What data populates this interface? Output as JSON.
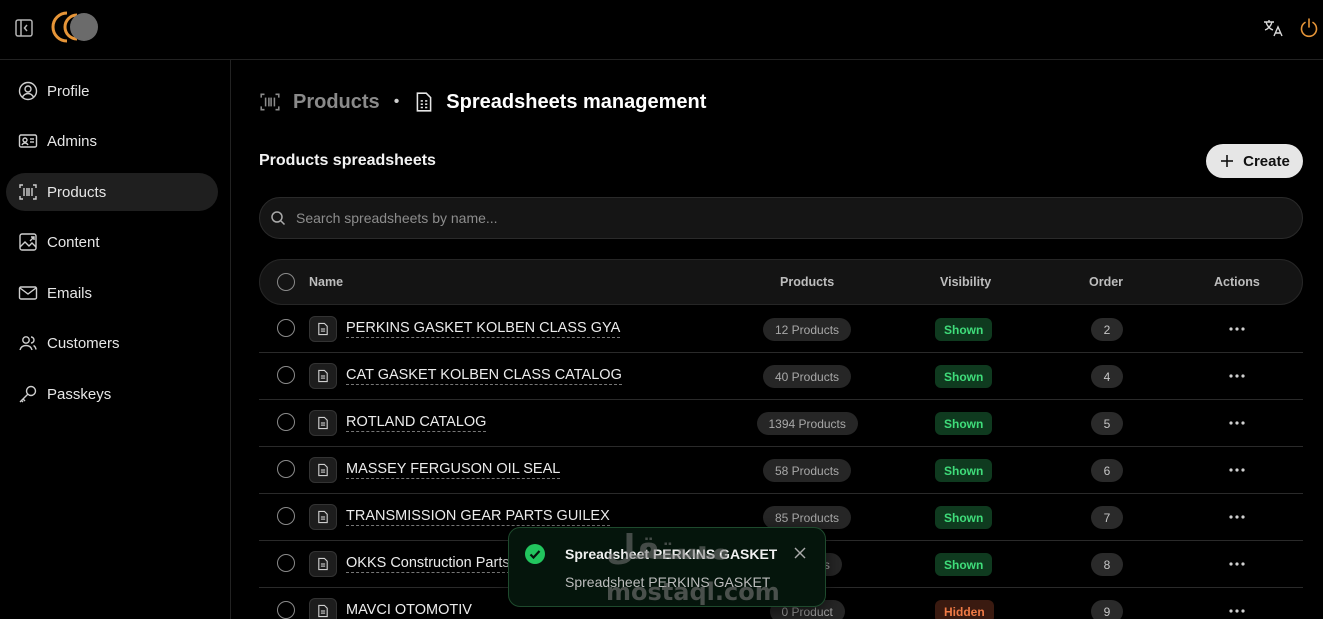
{
  "header": {
    "toggle_icon": "sidebar-toggle-icon",
    "logo_icon": "cc-logo",
    "translate_icon": "translate-icon",
    "power_icon": "power-icon",
    "colors": {
      "accent": "#e69538",
      "background": "#000000"
    }
  },
  "sidebar": {
    "items": [
      {
        "label": "Profile",
        "icon": "user-circle-icon"
      },
      {
        "label": "Admins",
        "icon": "id-card-icon"
      },
      {
        "label": "Products",
        "icon": "barcode-icon",
        "active": true
      },
      {
        "label": "Content",
        "icon": "image-icon"
      },
      {
        "label": "Emails",
        "icon": "mail-icon"
      },
      {
        "label": "Customers",
        "icon": "users-icon"
      },
      {
        "label": "Passkeys",
        "icon": "key-icon"
      }
    ]
  },
  "breadcrumb": {
    "parent": "Products",
    "separator": "•",
    "current": "Spreadsheets management"
  },
  "section": {
    "title": "Products spreadsheets",
    "create_label": "Create"
  },
  "search": {
    "placeholder": "Search spreadsheets by name...",
    "value": ""
  },
  "table": {
    "columns": [
      "Name",
      "Products",
      "Visibility",
      "Order",
      "Actions"
    ],
    "rows": [
      {
        "name": "PERKINS GASKET KOLBEN CLASS GYA",
        "products": "12 Products",
        "visibility": "Shown",
        "order": "2"
      },
      {
        "name": "CAT GASKET KOLBEN CLASS CATALOG",
        "products": "40 Products",
        "visibility": "Shown",
        "order": "4"
      },
      {
        "name": "ROTLAND CATALOG",
        "products": "1394 Products",
        "visibility": "Shown",
        "order": "5"
      },
      {
        "name": "MASSEY FERGUSON OIL SEAL",
        "products": "58 Products",
        "visibility": "Shown",
        "order": "6"
      },
      {
        "name": "TRANSMISSION GEAR PARTS GUILEX",
        "products": "85 Products",
        "visibility": "Shown",
        "order": "7"
      },
      {
        "name": "OKKS Construction Parts",
        "products": "...oducts",
        "visibility": "Shown",
        "order": "8"
      },
      {
        "name": "MAVCI OTOMOTIV",
        "products": "0 Product",
        "visibility": "Hidden",
        "order": "9"
      }
    ]
  },
  "toast": {
    "title": "Spreadsheet PERKINS GASKET",
    "description": "Spreadsheet PERKINS GASKET",
    "icon": "check-circle-icon",
    "close_icon": "close-icon"
  },
  "watermark": {
    "arabic": "مستقل",
    "latin": "mostaql.com"
  }
}
